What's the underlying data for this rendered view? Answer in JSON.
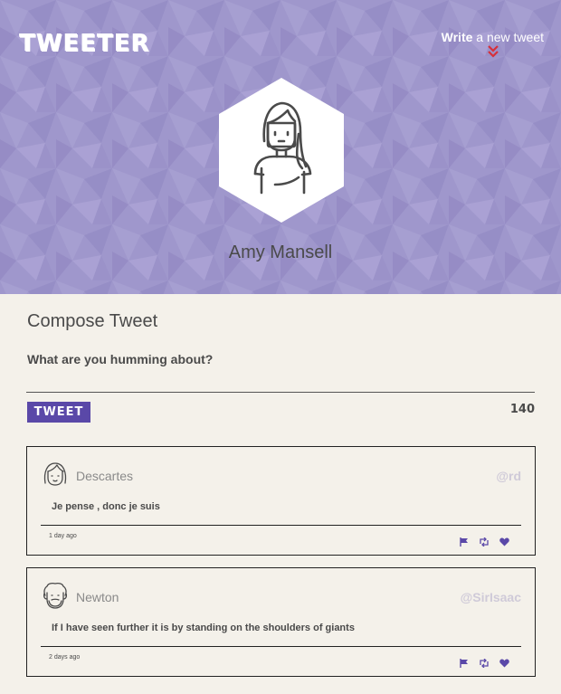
{
  "header": {
    "brand": "TWEETER",
    "write_link": {
      "bold": "Write",
      "rest": " a new tweet"
    },
    "profile_name": "Amy Mansell"
  },
  "compose": {
    "title": "Compose Tweet",
    "placeholder": "What are you humming about?",
    "button_label": "TWEET",
    "char_count": "140"
  },
  "tweets": [
    {
      "name": "Descartes",
      "handle": "@rd",
      "text": "Je pense , donc je suis",
      "time": "1 day ago",
      "avatar_icon": "girl-avatar-icon"
    },
    {
      "name": "Newton",
      "handle": "@SirIsaac",
      "text": "If I have seen further it is by standing on the shoulders of giants",
      "time": "2 days ago",
      "avatar_icon": "bearded-man-avatar-icon"
    }
  ],
  "colors": {
    "header_bg": "#9f97cc",
    "accent": "#5a48a8",
    "chevron": "#d6303a",
    "page_bg": "#f4f1ea",
    "text": "#4a4a4a"
  }
}
